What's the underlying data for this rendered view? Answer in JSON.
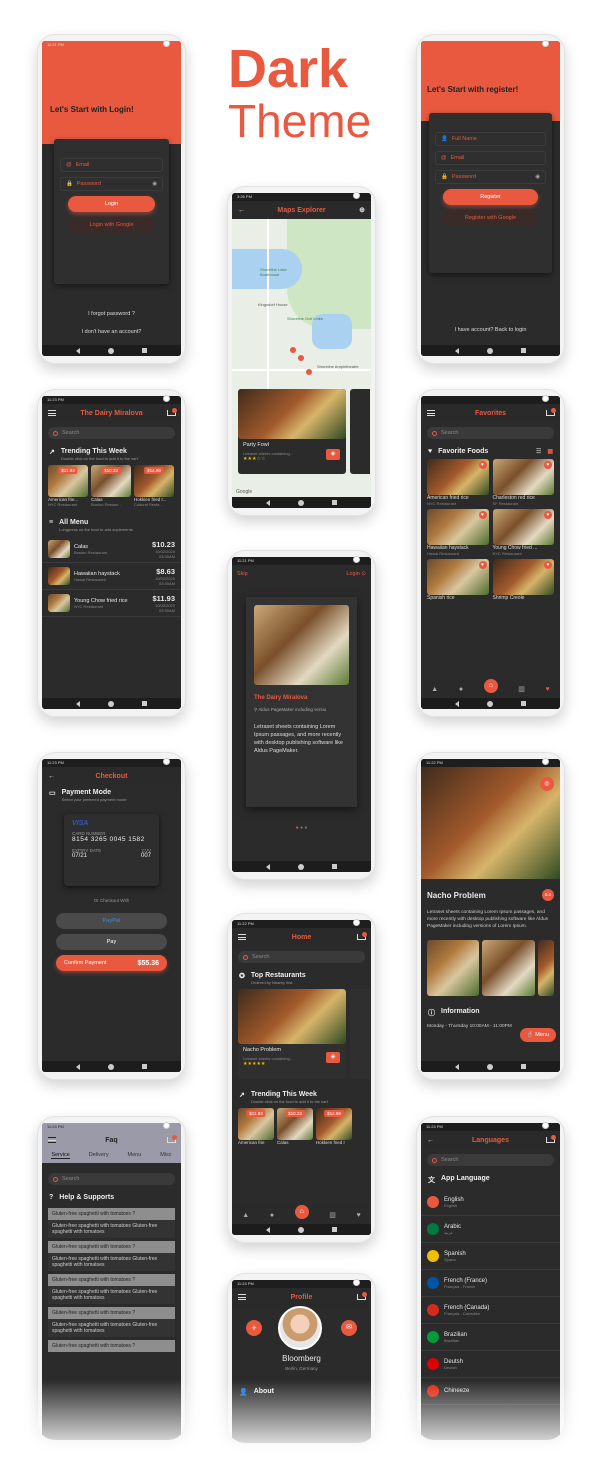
{
  "heading": {
    "line1": "Dark",
    "line2": "Theme"
  },
  "login": {
    "time": "11:21 PM",
    "title": "Let's Start with Login!",
    "email": "Email",
    "password": "Password",
    "login_btn": "Login",
    "google_btn": "Login with Google",
    "forgot": "I forgot password ?",
    "no_account": "I don't have an account?"
  },
  "register": {
    "title": "Let's Start with register!",
    "name": "Full Name",
    "email": "Email",
    "password": "Password",
    "register_btn": "Register",
    "google_btn": "Register with Google",
    "have_account": "I have account? Back to login"
  },
  "maps": {
    "time": "3:26 PM",
    "title": "Maps Explorer",
    "labels": [
      "Shoreline Lake Boathouse",
      "Kingsdorf House",
      "Shoreline Golf Links",
      "Shoreline Amphitheatre"
    ],
    "card_title": "Party Fowl",
    "card_desc": "Letraset sheets containing...",
    "stars": "★★★☆☆",
    "google": "Google"
  },
  "home1": {
    "time": "11:23 PM",
    "title": "The Dairy Miralova",
    "search": "Search",
    "trending_title": "Trending This Week",
    "trending_sub": "Double click on the food to add it to the cart",
    "trending": [
      {
        "price": "$11.93",
        "name": "American frie...",
        "rest": "NYC Restaurant"
      },
      {
        "price": "$10.23",
        "name": "Calas",
        "rest": "Boston Restaur..."
      },
      {
        "price": "$14.99",
        "name": "Hokkien fried r...",
        "rest": "Cultural Resta..."
      }
    ],
    "menu_title": "All Menu",
    "menu_sub": "Longpress on the food to add suplements",
    "menu": [
      {
        "name": "Calas",
        "rest": "Boston Restaurant",
        "price": "$10.23",
        "date": "10/02/2020",
        "time": "03:30AM"
      },
      {
        "name": "Hawaiian haystack",
        "rest": "Hawai Restaurant",
        "price": "$8.63",
        "date": "10/02/2020",
        "time": "03:30AM"
      },
      {
        "name": "Young Chow fried rice",
        "rest": "NYC Restaurant",
        "price": "$11.93",
        "date": "10/02/2020",
        "time": "03:30AM"
      }
    ]
  },
  "favorites": {
    "title": "Favorites",
    "search": "Search",
    "section": "Favorite Foods",
    "items": [
      {
        "name": "American fried rice",
        "rest": "NYC Restaurant"
      },
      {
        "name": "Charleston red rice",
        "rest": "SF Restaurant"
      },
      {
        "name": "Hawaiian haystack",
        "rest": "Hawai Restaurant"
      },
      {
        "name": "Young Chow fried ...",
        "rest": "NYC Restaurant"
      },
      {
        "name": "Spanish rice",
        "rest": ""
      },
      {
        "name": "Shrimp Creole",
        "rest": ""
      }
    ]
  },
  "onboard": {
    "time": "11:21 PM",
    "skip": "Skip",
    "login": "Login",
    "title": "The Dairy Miralova",
    "address": "Aldus PageMaker including versio",
    "desc": "Letraset sheets containing Lorem Ipsum passages, and more recently with desktop publishing software like Aldus PageMaker."
  },
  "checkout": {
    "time": "11:23 PM",
    "title": "Checkout",
    "section": "Payment Mode",
    "section_sub": "Select your preferred payment mode",
    "card_brand": "VISA",
    "card_label": "CARD NUMBER",
    "card_number": "8154 3265 0045 1582",
    "expiry_label": "EXPIRY DATE",
    "expiry": "07/21",
    "cvv_label": "CVV",
    "cvv": "007",
    "or": "Or Checkout With",
    "paypal": "PayPal",
    "applepay": "Pay",
    "confirm": "Confirm Payment",
    "total": "$55.36"
  },
  "detail": {
    "time": "11:22 PM",
    "title": "Nacho Problem",
    "badge": "5.0",
    "desc": "Letraset sheets containing Lorem Ipsum passages, and more recently with desktop publishing software like Aldus PageMaker including versions of Lorem Ipsum.",
    "info": "Information",
    "hours": "Monday - Thursday   10:00AM - 11:00PM",
    "menu_btn": "Menu"
  },
  "home2": {
    "time": "11:22 PM",
    "title": "Home",
    "search": "Search",
    "top_title": "Top Restaurants",
    "top_sub": "Ordered by Nearby first",
    "card_title": "Nacho Problem",
    "card_desc": "Letraset sheets containing...",
    "stars": "★★★★★",
    "trending_title": "Trending This Week",
    "trending_sub": "Double click on the food to add it to the cart",
    "trending": [
      {
        "price": "$11.93",
        "name": "American frie"
      },
      {
        "price": "$10.23",
        "name": "Calas"
      },
      {
        "price": "$14.99",
        "name": "Hokkien fried r"
      }
    ]
  },
  "faq": {
    "time": "11:24 PM",
    "title": "Faq",
    "tabs": [
      "Service",
      "Delivery",
      "Menu",
      "Misc"
    ],
    "search": "Search",
    "section": "Help & Supports",
    "q": "Gluten-free spaghetti with tomatoes ?",
    "a": "Gluten-free spaghetti with tomatoes Gluten-free spaghetti with tomatoes"
  },
  "languages": {
    "time": "11:24 PM",
    "title": "Languages",
    "search": "Search",
    "section": "App Language",
    "items": [
      {
        "name": "English",
        "sub": "English",
        "color": "#c8102e"
      },
      {
        "name": "Arabic",
        "sub": "عربية",
        "color": "#007a3d"
      },
      {
        "name": "Spanish",
        "sub": "Spana",
        "color": "#f1bf00"
      },
      {
        "name": "French (France)",
        "sub": "Français - France",
        "color": "#0055a4"
      },
      {
        "name": "French (Canada)",
        "sub": "Français - Canadien",
        "color": "#d52b1e"
      },
      {
        "name": "Brazilian",
        "sub": "Brazilian",
        "color": "#009c3b"
      },
      {
        "name": "Deutsh",
        "sub": "Deutsh",
        "color": "#dd0000"
      },
      {
        "name": "Chineeze",
        "sub": "",
        "color": "#de2910"
      }
    ]
  },
  "profile": {
    "time": "11:24 PM",
    "title": "Profile",
    "name": "Bloomberg",
    "location": "Berlin, Germany",
    "about": "About"
  }
}
